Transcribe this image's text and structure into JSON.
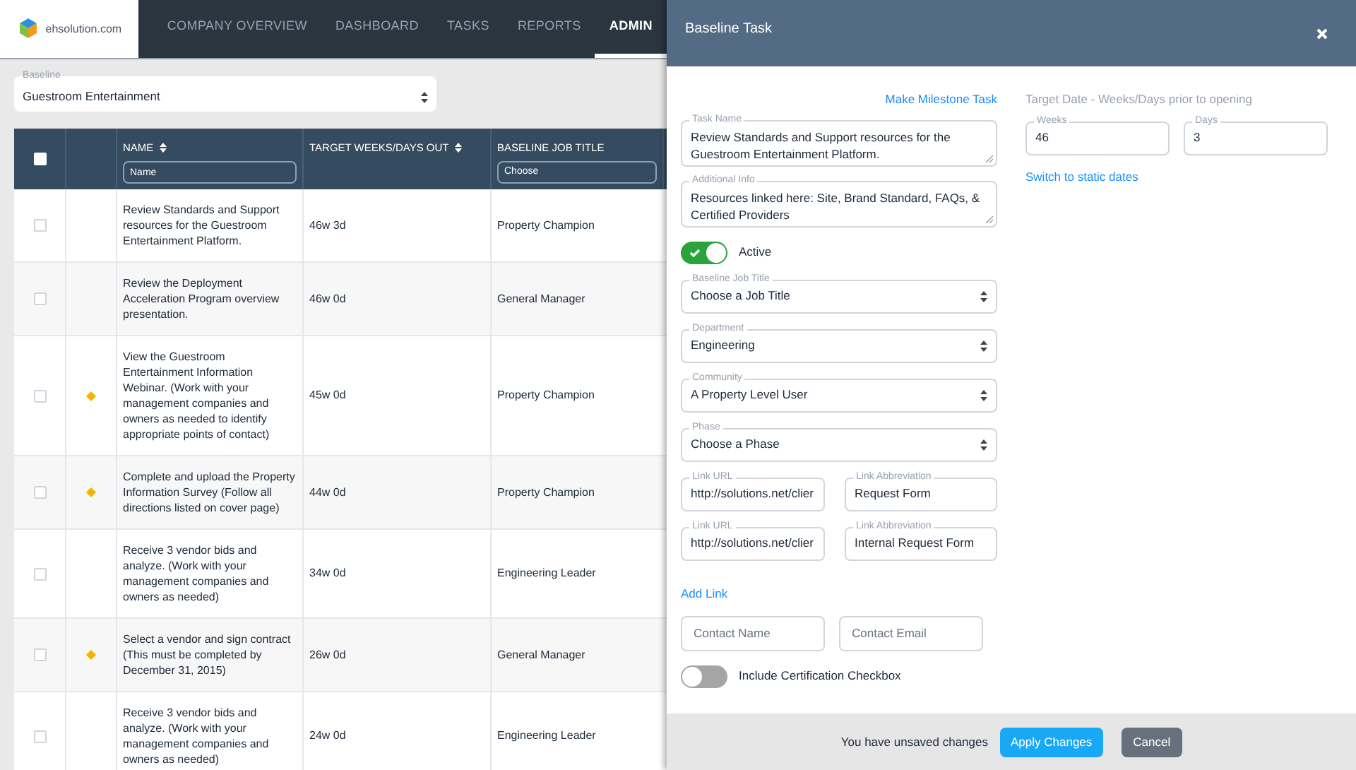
{
  "nav": {
    "logo": "ehsolution.com",
    "items": [
      {
        "label": "COMPANY OVERVIEW",
        "selected": false
      },
      {
        "label": "DASHBOARD",
        "selected": false
      },
      {
        "label": "TASKS",
        "selected": false
      },
      {
        "label": "REPORTS",
        "selected": false
      },
      {
        "label": "ADMIN",
        "selected": true
      }
    ]
  },
  "baseline": {
    "label": "Baseline",
    "value": "Guestroom Entertainment"
  },
  "table": {
    "select_all_checked": false,
    "columns": [
      {
        "label": "NAME",
        "sortable": true,
        "filter": {
          "kind": "input",
          "placeholder": "Name"
        }
      },
      {
        "label": "TARGET WEEKS/DAYS OUT",
        "sortable": true
      },
      {
        "label": "BASELINE JOB TITLE",
        "sortable": false,
        "filter": {
          "kind": "select",
          "value": "Choose"
        }
      }
    ],
    "rows": [
      {
        "checked": false,
        "milestone": false,
        "name": "Review Standards and Support resources for the Guestroom Entertainment Platform.",
        "target": "46w 3d",
        "job_title": "Property Champion"
      },
      {
        "checked": false,
        "milestone": false,
        "name": "Review the Deployment Acceleration Program overview presentation.",
        "target": "46w 0d",
        "job_title": "General Manager"
      },
      {
        "checked": false,
        "milestone": true,
        "name": "View the Guestroom Entertainment Information Webinar. (Work with your management companies and owners as needed to identify appropriate points of contact)",
        "target": "45w 0d",
        "job_title": "Property Champion"
      },
      {
        "checked": false,
        "milestone": true,
        "name": "Complete and upload the Property Information Survey (Follow all directions listed on cover page)",
        "target": "44w 0d",
        "job_title": "Property Champion"
      },
      {
        "checked": false,
        "milestone": false,
        "name": "Receive 3 vendor bids and analyze. (Work with your management companies and owners as needed)",
        "target": "34w 0d",
        "job_title": "Engineering Leader"
      },
      {
        "checked": false,
        "milestone": true,
        "name": "Select a vendor and sign contract (This must be completed by December 31, 2015)",
        "target": "26w 0d",
        "job_title": "General Manager"
      },
      {
        "checked": false,
        "milestone": false,
        "name": "Receive 3 vendor bids and analyze. (Work with your management companies and owners as needed)",
        "target": "24w 0d",
        "job_title": "Engineering Leader"
      }
    ]
  },
  "panel": {
    "title": "Baseline Task",
    "milestone_link": "Make Milestone Task",
    "task_name": {
      "label": "Task Name",
      "value": "Review Standards and Support resources for the Guestroom Entertainment Platform."
    },
    "additional_info": {
      "label": "Additional Info",
      "value": "Resources linked here: Site, Brand Standard, FAQs, & Certified Providers"
    },
    "active": {
      "label": "Active",
      "on": true
    },
    "selects": [
      {
        "label": "Baseline Job Title",
        "value": "Choose a Job Title"
      },
      {
        "label": "Department",
        "value": "Engineering"
      },
      {
        "label": "Community",
        "value": "A Property Level User"
      },
      {
        "label": "Phase",
        "value": "Choose a Phase"
      }
    ],
    "links": [
      {
        "url": {
          "label": "Link URL",
          "value": "http://solutions.net/clier"
        },
        "abbreviation": {
          "label": "Link Abbreviation",
          "value": "Request Form"
        }
      },
      {
        "url": {
          "label": "Link URL",
          "value": "http://solutions.net/clier"
        },
        "abbreviation": {
          "label": "Link Abbreviation",
          "value": "Internal Request Form"
        }
      }
    ],
    "add_link": "Add Link",
    "contact": [
      {
        "placeholder": "Contact Name"
      },
      {
        "placeholder": "Contact Email"
      }
    ],
    "certification": {
      "label": "Include Certification Checkbox",
      "on": false
    },
    "target": {
      "heading": "Target Date - Weeks/Days prior to opening",
      "weeks": {
        "label": "Weeks",
        "value": "46"
      },
      "days": {
        "label": "Days",
        "value": "3"
      },
      "switch_link": "Switch to static dates"
    },
    "footer": {
      "message": "You have unsaved changes",
      "apply": "Apply Changes",
      "cancel": "Cancel"
    }
  }
}
